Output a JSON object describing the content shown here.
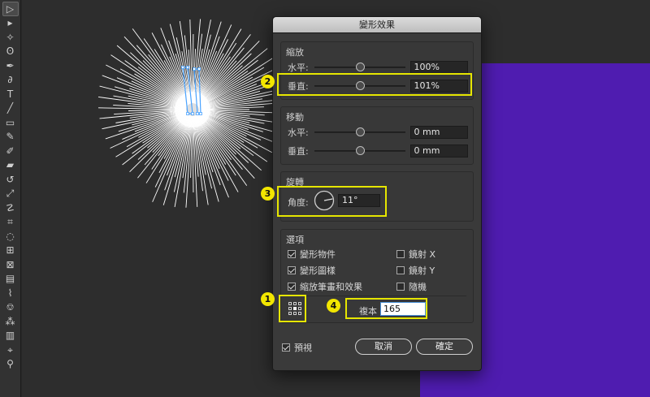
{
  "toolbar": {
    "tools": [
      {
        "name": "selection-tool",
        "glyph": "▷"
      },
      {
        "name": "direct-selection-tool",
        "glyph": "▸"
      },
      {
        "name": "magic-wand-tool",
        "glyph": "✧"
      },
      {
        "name": "lasso-tool",
        "glyph": "ʘ"
      },
      {
        "name": "pen-tool",
        "glyph": "✒"
      },
      {
        "name": "curvature-tool",
        "glyph": "∂"
      },
      {
        "name": "type-tool",
        "glyph": "T"
      },
      {
        "name": "line-tool",
        "glyph": "╱"
      },
      {
        "name": "rectangle-tool",
        "glyph": "▭"
      },
      {
        "name": "paintbrush-tool",
        "glyph": "✎"
      },
      {
        "name": "shaper-tool",
        "glyph": "✐"
      },
      {
        "name": "eraser-tool",
        "glyph": "▰"
      },
      {
        "name": "rotate-tool",
        "glyph": "↺"
      },
      {
        "name": "scale-tool",
        "glyph": "⤢"
      },
      {
        "name": "warp-tool",
        "glyph": "☡"
      },
      {
        "name": "free-transform-tool",
        "glyph": "⌗"
      },
      {
        "name": "shape-builder-tool",
        "glyph": "◌"
      },
      {
        "name": "perspective-grid-tool",
        "glyph": "⊞"
      },
      {
        "name": "mesh-tool",
        "glyph": "⊠"
      },
      {
        "name": "gradient-tool",
        "glyph": "▤"
      },
      {
        "name": "eyedropper-tool",
        "glyph": "⌇"
      },
      {
        "name": "blend-tool",
        "glyph": "⎊"
      },
      {
        "name": "symbol-sprayer-tool",
        "glyph": "⁂"
      },
      {
        "name": "column-graph-tool",
        "glyph": "▥"
      },
      {
        "name": "artboard-tool",
        "glyph": "⌖"
      },
      {
        "name": "slice-tool",
        "glyph": "⚲"
      }
    ]
  },
  "colors": {
    "artboard": "#4f1cb0",
    "highlight": "#e6e600",
    "burst": "#ffffff"
  },
  "dialog": {
    "title": "變形效果",
    "scale": {
      "label": "縮放",
      "horizontal_label": "水平:",
      "horizontal_value": "100%",
      "horizontal_position": 0.5,
      "vertical_label": "垂直:",
      "vertical_value": "101%",
      "vertical_position": 0.5
    },
    "move": {
      "label": "移動",
      "horizontal_label": "水平:",
      "horizontal_value": "0 mm",
      "horizontal_position": 0.5,
      "vertical_label": "垂直:",
      "vertical_value": "0 mm",
      "vertical_position": 0.5
    },
    "rotate": {
      "label": "旋轉",
      "angle_label": "角度:",
      "angle_value": "11°",
      "angle_degrees": 11
    },
    "options": {
      "label": "選項",
      "transform_objects": "變形物件",
      "transform_objects_checked": true,
      "transform_patterns": "變形圖樣",
      "transform_patterns_checked": true,
      "scale_strokes": "縮放筆畫和效果",
      "scale_strokes_checked": true,
      "reflect_x": "鏡射 X",
      "reflect_x_checked": false,
      "reflect_y": "鏡射 Y",
      "reflect_y_checked": false,
      "random": "隨機",
      "random_checked": false
    },
    "copies_label": "複本",
    "copies_value": "165",
    "preview_label": "預視",
    "preview_checked": true,
    "cancel_label": "取消",
    "ok_label": "確定"
  },
  "annotations": {
    "badge_1": "1",
    "badge_2": "2",
    "badge_3": "3",
    "badge_4": "4"
  }
}
